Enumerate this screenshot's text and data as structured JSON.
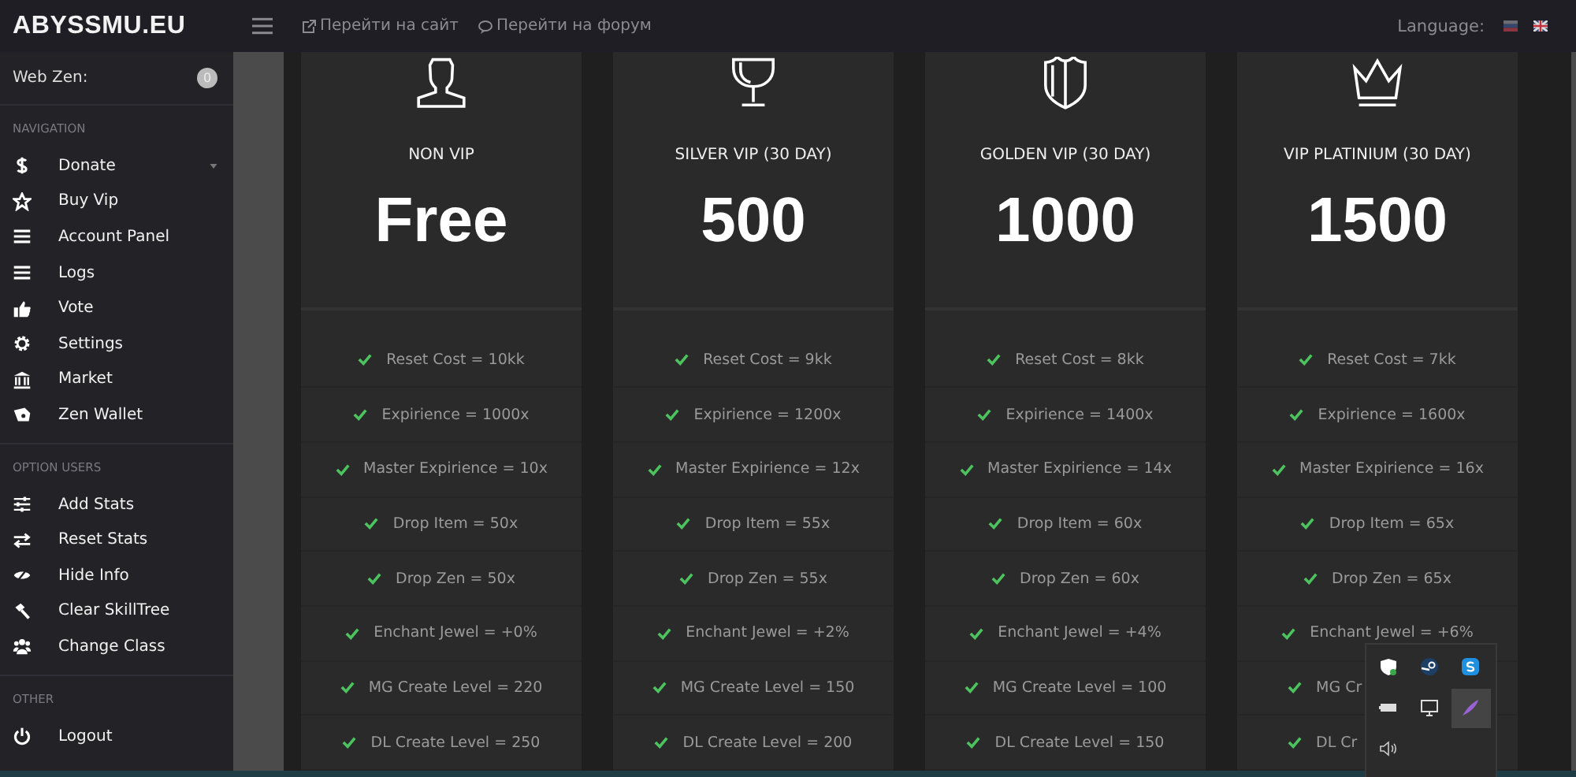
{
  "header": {
    "logo": "ABYSSMU.EU",
    "links": [
      {
        "label": "Перейти на сайт"
      },
      {
        "label": "Перейти на форум"
      }
    ],
    "language_label": "Language:"
  },
  "sidebar": {
    "balance": {
      "label": "Web Zen:",
      "count": "0"
    },
    "sections": [
      {
        "title": "NAVIGATION",
        "items": [
          {
            "label": "Donate",
            "expandable": true
          },
          {
            "label": "Buy Vip",
            "expandable": false
          },
          {
            "label": "Account Panel",
            "expandable": false
          },
          {
            "label": "Logs",
            "expandable": false
          },
          {
            "label": "Vote",
            "expandable": false
          },
          {
            "label": "Settings",
            "expandable": false
          },
          {
            "label": "Market",
            "expandable": false
          },
          {
            "label": "Zen Wallet",
            "expandable": false
          }
        ]
      },
      {
        "title": "OPTION USERS",
        "items": [
          {
            "label": "Add Stats",
            "expandable": false
          },
          {
            "label": "Reset Stats",
            "expandable": false
          },
          {
            "label": "Hide Info",
            "expandable": false
          },
          {
            "label": "Clear SkillTree",
            "expandable": false
          },
          {
            "label": "Change Class",
            "expandable": false
          }
        ]
      },
      {
        "title": "OTHER",
        "items": [
          {
            "label": "Logout",
            "expandable": false
          }
        ]
      }
    ]
  },
  "plans": [
    {
      "name": "NON VIP",
      "price": "Free",
      "features": [
        {
          "text": "Reset Cost = 10kk",
          "kind": "full"
        },
        {
          "text": "Expirience = 1000x",
          "kind": "full"
        },
        {
          "text": "Master Expirience = 10x",
          "kind": "full"
        },
        {
          "text": "Drop Item = 50x",
          "kind": "full"
        },
        {
          "text": "Drop Zen = 50x",
          "kind": "full"
        },
        {
          "text": "Enchant Jewel = +0%",
          "kind": "full"
        },
        {
          "text": "MG Create Level = 220",
          "kind": "full"
        },
        {
          "text": "DL Create Level = 250",
          "kind": "full"
        }
      ]
    },
    {
      "name": "SILVER VIP (30 DAY)",
      "price": "500",
      "features": [
        {
          "text": "Reset Cost = 9kk",
          "kind": "full"
        },
        {
          "text": "Expirience = 1200x",
          "kind": "full"
        },
        {
          "text": "Master Expirience = 12x",
          "kind": "full"
        },
        {
          "text": "Drop Item = 55x",
          "kind": "full"
        },
        {
          "text": "Drop Zen = 55x",
          "kind": "full"
        },
        {
          "text": "Enchant Jewel = +2%",
          "kind": "full"
        },
        {
          "text": "MG Create Level = 150",
          "kind": "full"
        },
        {
          "text": "DL Create Level = 200",
          "kind": "full"
        }
      ]
    },
    {
      "name": "GOLDEN VIP (30 DAY)",
      "price": "1000",
      "features": [
        {
          "text": "Reset Cost = 8kk",
          "kind": "full"
        },
        {
          "text": "Expirience = 1400x",
          "kind": "full"
        },
        {
          "text": "Master Expirience = 14x",
          "kind": "full"
        },
        {
          "text": "Drop Item = 60x",
          "kind": "full"
        },
        {
          "text": "Drop Zen = 60x",
          "kind": "full"
        },
        {
          "text": "Enchant Jewel = +4%",
          "kind": "full"
        },
        {
          "text": "MG Create Level = 100",
          "kind": "full"
        },
        {
          "text": "DL Create Level = 150",
          "kind": "full"
        }
      ]
    },
    {
      "name": "VIP PLATINIUM (30 DAY)",
      "price": "1500",
      "features": [
        {
          "text": "Reset Cost = 7kk",
          "kind": "full"
        },
        {
          "text": "Expirience = 1600x",
          "kind": "full"
        },
        {
          "text": "Master Expirience = 16x",
          "kind": "full"
        },
        {
          "text": "Drop Item = 65x",
          "kind": "full"
        },
        {
          "text": "Drop Zen = 65x",
          "kind": "full"
        },
        {
          "text": "Enchant Jewel = +6%",
          "kind": "full"
        },
        {
          "text": "MG Cr",
          "kind": "cut"
        },
        {
          "text": "DL Cr",
          "kind": "cut"
        }
      ]
    }
  ]
}
